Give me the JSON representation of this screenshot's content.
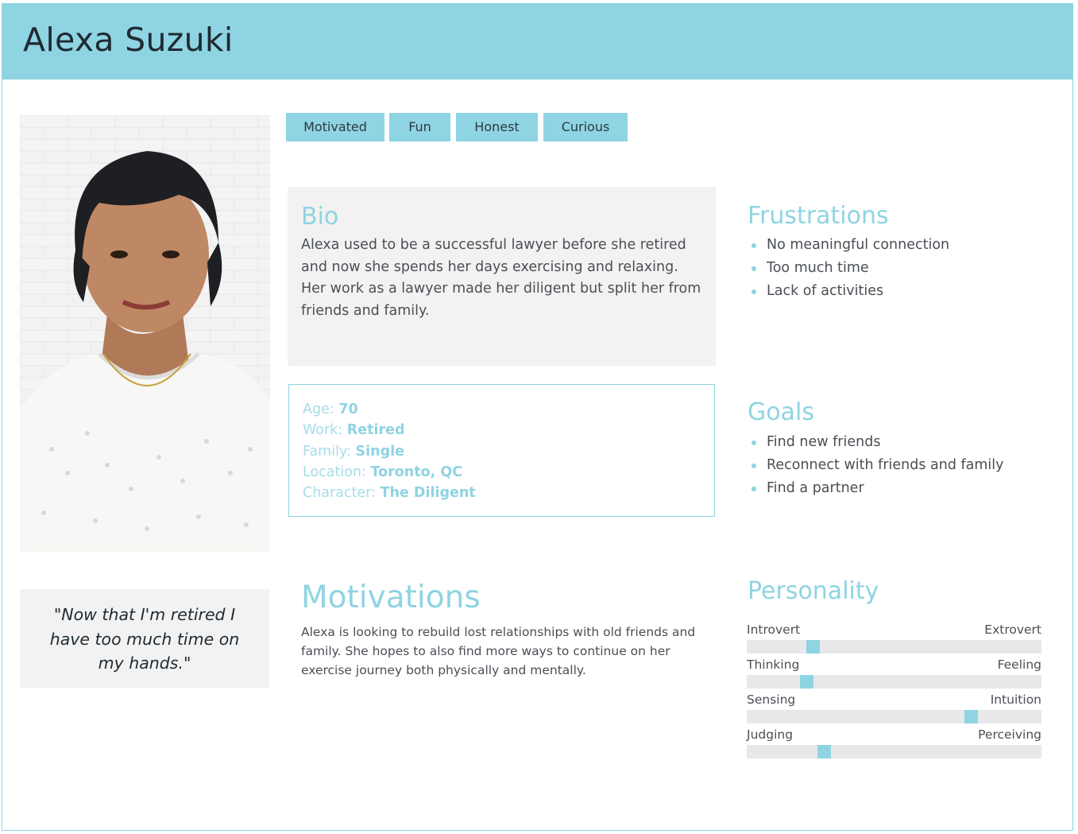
{
  "persona": {
    "name": "Alexa Suzuki",
    "photo_icon": "portrait-photo"
  },
  "tags": [
    "Motivated",
    "Fun",
    "Honest",
    "Curious"
  ],
  "bio": {
    "title": "Bio",
    "text": "Alexa used to be a successful lawyer before she retired and now she spends her days exercising and relaxing. Her work as a lawyer made her diligent but split her from friends and family."
  },
  "details": [
    {
      "label": "Age:",
      "value": "70"
    },
    {
      "label": "Work:",
      "value": "Retired"
    },
    {
      "label": "Family:",
      "value": "Single"
    },
    {
      "label": "Location:",
      "value": "Toronto, QC"
    },
    {
      "label": "Character:",
      "value": "The Diligent"
    }
  ],
  "frustrations": {
    "title": "Frustrations",
    "items": [
      "No meaningful connection",
      "Too much time",
      "Lack of activities"
    ]
  },
  "goals": {
    "title": "Goals",
    "items": [
      "Find new friends",
      "Reconnect with friends and family",
      "Find a partner"
    ]
  },
  "quote": "\"Now that I'm retired I have too much time on my hands.\"",
  "motivations": {
    "title": "Motivations",
    "text": "Alexa is looking to rebuild lost relationships with old friends and family. She hopes to also find more ways to continue on her exercise journey both physically and mentally."
  },
  "personality": {
    "title": "Personality",
    "traits": [
      {
        "left": "Introvert",
        "right": "Extrovert",
        "level": 0.223
      },
      {
        "left": "Thinking",
        "right": "Feeling",
        "level": 0.203
      },
      {
        "left": "Sensing",
        "right": "Intuition",
        "level": 0.76
      },
      {
        "left": "Judging",
        "right": "Perceiving",
        "level": 0.262
      }
    ]
  },
  "colors": {
    "accent": "#8fd4e2",
    "panel": "#f2f2f2",
    "track": "#e8e8ea",
    "text": "#4a4f55",
    "heading": "#1f2a33"
  }
}
